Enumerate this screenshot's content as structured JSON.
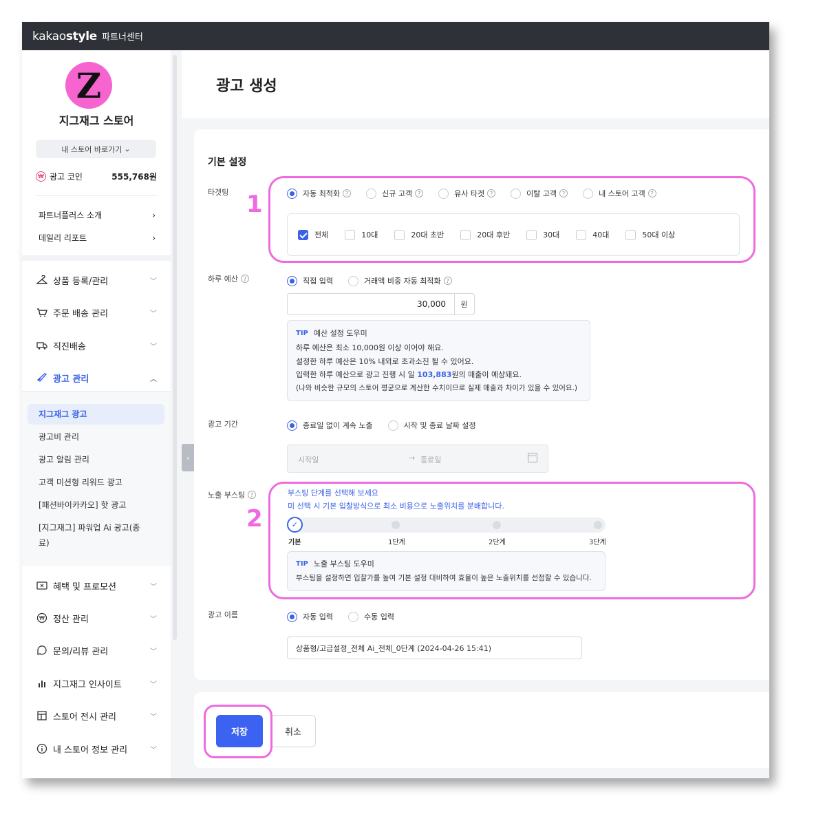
{
  "brand": {
    "logo_main": "kakao",
    "logo_bold": "style",
    "subtitle": "파트너센터"
  },
  "sidebar": {
    "avatar_letter": "Z",
    "store_name": "지그재그 스토어",
    "store_link": "내 스토어 바로가기",
    "coin_label": "광고 코인",
    "coin_value": "555,768원",
    "links": [
      "파트너플러스 소개",
      "데일리 리포트"
    ],
    "menu": [
      {
        "label": "상품 등록/관리",
        "icon": "hanger-icon"
      },
      {
        "label": "주문 배송 관리",
        "icon": "cart-icon"
      },
      {
        "label": "직진배송",
        "icon": "truck-icon"
      },
      {
        "label": "광고 관리",
        "icon": "rocket-icon"
      }
    ],
    "ad_submenu": [
      "지그재그 광고",
      "광고비 관리",
      "광고 알림 관리",
      "고객 미션형 리워드 광고",
      "[패션바이카카오] 핫 광고",
      "[지그재그] 파워업 Ai 광고(종",
      "료)"
    ],
    "menu2": [
      {
        "label": "혜택 및 프로모션",
        "icon": "coupon-icon"
      },
      {
        "label": "정산 관리",
        "icon": "won-icon"
      },
      {
        "label": "문의/리뷰 관리",
        "icon": "chat-icon"
      },
      {
        "label": "지그재그 인사이트",
        "icon": "bar-chart-icon"
      },
      {
        "label": "스토어 전시 관리",
        "icon": "layout-icon"
      },
      {
        "label": "내 스토어 정보 관리",
        "icon": "info-icon"
      }
    ]
  },
  "page": {
    "title": "광고 생성",
    "section_title": "기본 설정"
  },
  "targeting": {
    "label": "타겟팅",
    "options": [
      "자동 최적화",
      "신규 고객",
      "유사 타겟",
      "이탈 고객",
      "내 스토어 고객"
    ],
    "ages": [
      "전체",
      "10대",
      "20대 초반",
      "20대 후반",
      "30대",
      "40대",
      "50대 이상"
    ]
  },
  "budget": {
    "label": "하루 예산",
    "options": [
      "직접 입력",
      "거래액 비중 자동 최적화"
    ],
    "value": "30,000",
    "unit": "원",
    "tip_tag": "TIP",
    "tip_title": "예산 설정 도우미",
    "tip_lines": [
      "하루 예산은 최소 10,000원 이상 이어야 해요.",
      "설정한 하루 예산은 10% 내외로 초과소진 될 수 있어요."
    ],
    "tip_line3_pre": "입력한 하루 예산으로 광고 진행 시 일 ",
    "tip_line3_value": "103,883",
    "tip_line3_post": "원의 매출이 예상돼요.",
    "tip_line4": "(나와 비슷한 규모의 스토어 평균으로 계산한 수치이므로 실제 매출과 차이가 있을 수 있어요.)"
  },
  "period": {
    "label": "광고 기간",
    "options": [
      "종료일 없이 계속 노출",
      "시작 및 종료 날짜 설정"
    ],
    "start_placeholder": "시작일",
    "end_placeholder": "종료일"
  },
  "boost": {
    "label": "노출 부스팅",
    "hint1": "부스팅 단계를 선택해 보세요",
    "hint2": "미 선택 시 기본 입찰방식으로 최소 비용으로 노출위치를 분배합니다.",
    "steps": [
      "기본",
      "1단계",
      "2단계",
      "3단계"
    ],
    "selected_step": 0,
    "tip_tag": "TIP",
    "tip_title": "노출 부스팅 도우미",
    "tip_text": "부스팅을 설정하면 입찰가를 높여 기본 설정 대비하여 효율이 높은 노출위치를 선점할 수 있습니다."
  },
  "ad_name": {
    "label": "광고 이름",
    "options": [
      "자동 입력",
      "수동 입력"
    ],
    "value": "상품형/고급설정_전체 Ai_전체_0단계 (2024-04-26 15:41)"
  },
  "actions": {
    "save": "저장",
    "cancel": "취소"
  },
  "annotations": {
    "box1": "1",
    "box2": "2"
  },
  "colors": {
    "accent": "#3b62e6",
    "highlight": "#ef6ae0",
    "topbar": "#2f3138",
    "avatar": "#f564cf"
  }
}
